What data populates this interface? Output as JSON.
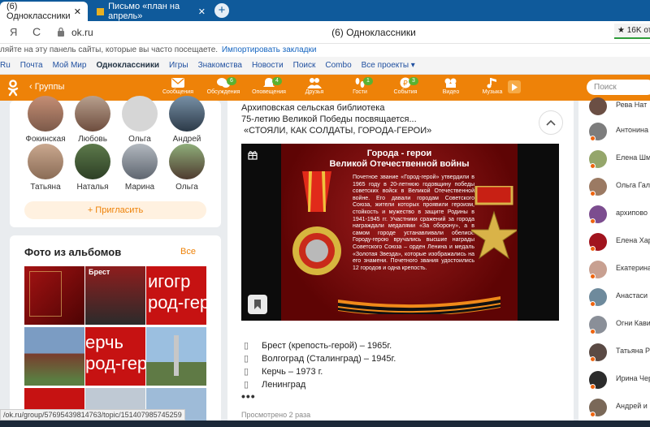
{
  "browser": {
    "tabs": [
      {
        "label": "(6) Одноклассники",
        "close": "✕"
      },
      {
        "label": "Письмо «план на апрель»",
        "close": "✕"
      }
    ],
    "new_tab": "+",
    "yandex_label": "Я",
    "reload_label": "C",
    "url": "ok.ru",
    "page_title": "(6) Одноклассники",
    "notification_badge": "★ 16K отз",
    "bookmarks_hint": "ляйте на эту панель сайты, которые вы часто посещаете.",
    "bookmarks_import": "Импортировать закладки",
    "status_url": "/ok.ru/group/57695439814763/topic/151407985745259"
  },
  "portal_links": [
    "Ru",
    "Почта",
    "Мой Мир",
    "Одноклассники",
    "Игры",
    "Знакомства",
    "Новости",
    "Поиск",
    "Combo",
    "Все проекты ▾"
  ],
  "toolbar": {
    "groups_label": "‹  Группы",
    "items": [
      {
        "label": "Сообщения",
        "badge": ""
      },
      {
        "label": "Обсуждения",
        "badge": "6"
      },
      {
        "label": "Оповещения",
        "badge": "4"
      },
      {
        "label": "Друзья",
        "badge": ""
      },
      {
        "label": "Гости",
        "badge": "1"
      },
      {
        "label": "События",
        "badge": "3"
      },
      {
        "label": "Видео",
        "badge": ""
      },
      {
        "label": "Музыка",
        "badge": ""
      }
    ],
    "search_placeholder": "Поиск"
  },
  "friends": {
    "top_row": [
      "Фокинская",
      "Любовь",
      "Ольга",
      "Андрей"
    ],
    "second_row": [
      "Татьяна",
      "Наталья",
      "Марина",
      "Ольга"
    ],
    "invite": "+ Пригласить"
  },
  "photos": {
    "title": "Фото из альбомов",
    "all": "Все",
    "tiles": [
      {
        "caption": ""
      },
      {
        "caption": "Брест"
      },
      {
        "caption": "игогр\nрод-гер"
      },
      {
        "caption": ""
      },
      {
        "caption": "ерчь\nрод-гер"
      },
      {
        "caption": ""
      }
    ]
  },
  "post": {
    "lines": [
      "Архиповская сельская библиотека",
      "75-летию Великой Победы посвящается...",
      " «СТОЯЛИ, КАК СОЛДАТЫ, ГОРОДА-ГЕРОИ»"
    ],
    "poster_title_1": "Города - герои",
    "poster_title_2": "Великой Отечественной войны",
    "poster_body": "Почетное звание «Город-герой» утвердили в 1965 году в 20-летнюю годовщину победы советских войск в Великой Отечественной войне. Его давали городам Советского Союза, жители которых проявили героизм, стойкость и мужество в защите Родины в 1941-1945 гг. Участники сражений за города награждали медалями «За оборону», а в самом городе устанавливали обелиск. Городу-герою вручались высшие награды Советского Союза – орден Ленина и медаль «Золотая Звезда», которые изображались на его знамени. Почетного звания удостоились 12 городов и одна крепость.",
    "cities": [
      "Брест (крепость-герой) – 1965г.",
      "Волгоград (Сталинград) – 1945г.",
      "Керчь – 1973 г.",
      "Ленинград"
    ],
    "bullet": "▯",
    "more": "•••",
    "views": "Просмотрено 2 раза"
  },
  "right_friends": [
    "Рева Нат",
    "Антонина",
    "Елена Шм",
    "Ольга Гал",
    "архипово",
    "Елена Хар",
    "Екатерина",
    "Анастаси",
    "Огни Кави",
    "Татьяна Р",
    "Ирина Чер",
    "Андрей и"
  ],
  "colors": {
    "ok_orange": "#ee8208",
    "tab_blue": "#0f5a9b",
    "badge_green": "#5bb231",
    "poster_red": "#8c1111"
  }
}
